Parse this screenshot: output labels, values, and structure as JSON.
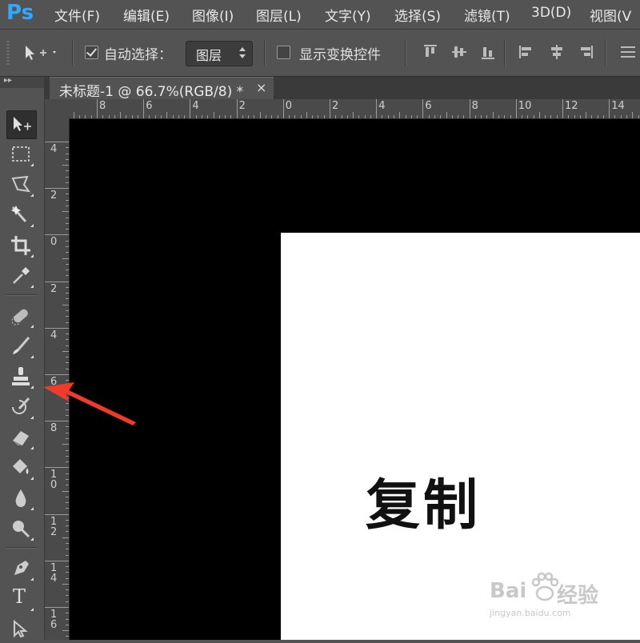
{
  "app": {
    "logo": "Ps"
  },
  "menu": [
    {
      "label": "文件(F)"
    },
    {
      "label": "编辑(E)"
    },
    {
      "label": "图像(I)"
    },
    {
      "label": "图层(L)"
    },
    {
      "label": "文字(Y)"
    },
    {
      "label": "选择(S)"
    },
    {
      "label": "滤镜(T)"
    },
    {
      "label": "3D(D)"
    },
    {
      "label": "视图(V"
    }
  ],
  "options": {
    "auto_select_label": "自动选择：",
    "auto_select_checked": true,
    "target_value": "图层",
    "show_transform_label": "显示变换控件",
    "show_transform_checked": false
  },
  "toolbar": {
    "collapse_glyph": "▸▸",
    "tools": [
      {
        "name": "move-tool-icon"
      },
      {
        "name": "rectangular-marquee-tool-icon"
      },
      {
        "name": "lasso-tool-icon"
      },
      {
        "name": "magic-wand-tool-icon"
      },
      {
        "name": "crop-tool-icon"
      },
      {
        "name": "eyedropper-tool-icon"
      },
      {
        "name": "spot-healing-brush-tool-icon"
      },
      {
        "name": "brush-tool-icon"
      },
      {
        "name": "clone-stamp-tool-icon"
      },
      {
        "name": "history-brush-tool-icon"
      },
      {
        "name": "eraser-tool-icon"
      },
      {
        "name": "paint-bucket-tool-icon"
      },
      {
        "name": "blur-tool-icon"
      },
      {
        "name": "dodge-tool-icon"
      },
      {
        "name": "pen-tool-icon"
      },
      {
        "name": "type-tool-icon"
      }
    ],
    "type_glyph": "T"
  },
  "document": {
    "tab_title": "未标题-1 @ 66.7%(RGB/8) *",
    "close_glyph": "×",
    "canvas_text": "复制",
    "canvas_bg": "#000000",
    "doc_bg": "#ffffff"
  },
  "rulers": {
    "horizontal": [
      "8",
      "6",
      "4",
      "2",
      "0",
      "2",
      "4",
      "6",
      "8",
      "10",
      "12",
      "14"
    ],
    "vertical": [
      "4",
      "2",
      "0",
      "2",
      "4",
      "6",
      "8",
      "10",
      "12",
      "14",
      "16"
    ]
  },
  "annotation": {
    "arrow_color": "#f03a2c"
  },
  "watermark": {
    "brand_left": "Bai",
    "brand_right": "经验",
    "url": "jingyan.baidu.com"
  }
}
